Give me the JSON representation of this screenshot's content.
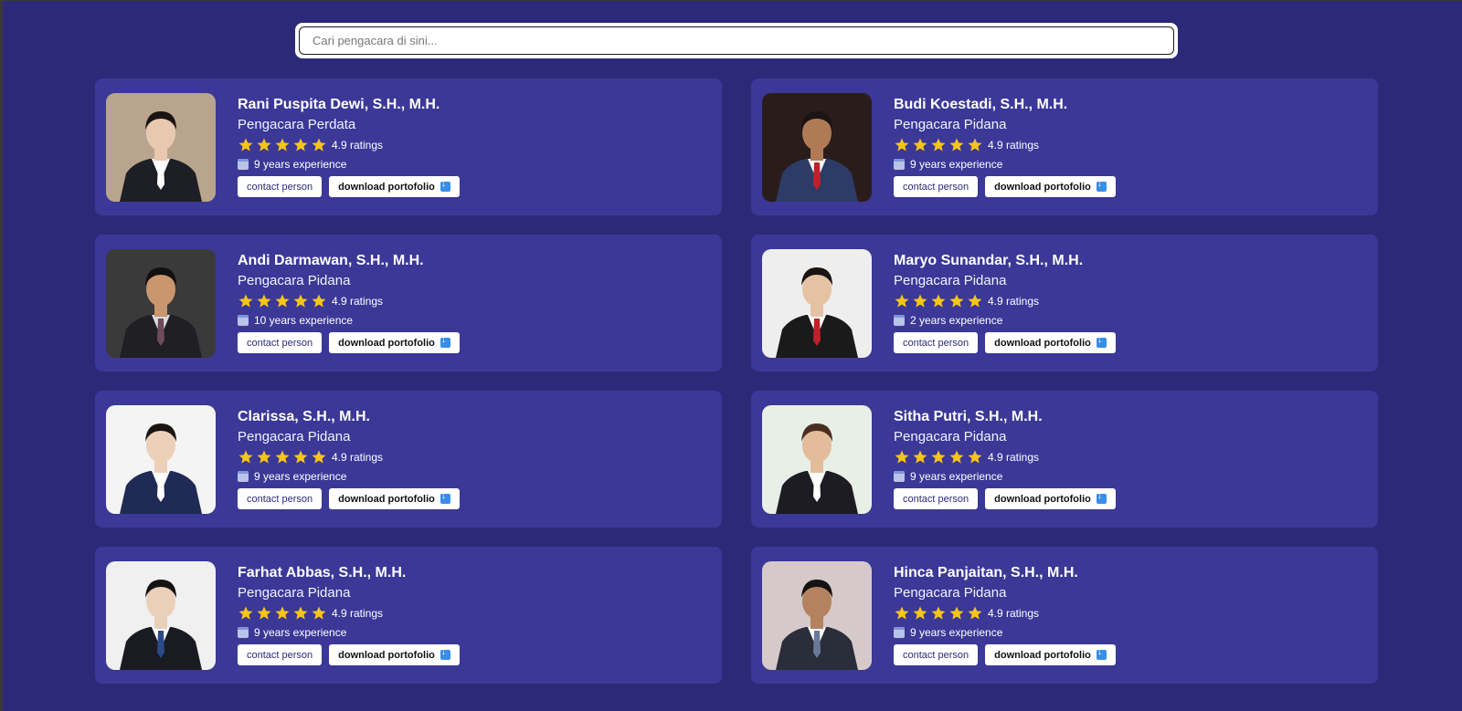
{
  "search": {
    "placeholder": "Cari pengacara di sini..."
  },
  "colors": {
    "background": "#2c2a78",
    "card": "#3b3897",
    "star": "#f5c518"
  },
  "lawyers": [
    {
      "name": "Rani Puspita Dewi, S.H., M.H.",
      "specialty": "Pengacara Perdata",
      "rating": "4.9 ratings",
      "experience": "9 years experience",
      "contact": "contact person",
      "download": "download portofolio",
      "photo": "female-lawyer-desk-photo"
    },
    {
      "name": "Budi Koestadi, S.H., M.H.",
      "specialty": "Pengacara Pidana",
      "rating": "4.9 ratings",
      "experience": "9 years experience",
      "contact": "contact person",
      "download": "download portofolio",
      "photo": "male-lawyer-red-tie-photo"
    },
    {
      "name": "Andi Darmawan, S.H., M.H.",
      "specialty": "Pengacara Pidana",
      "rating": "4.9 ratings",
      "experience": "10 years experience",
      "contact": "contact person",
      "download": "download portofolio",
      "photo": "male-lawyer-glasses-photo"
    },
    {
      "name": "Maryo Sunandar, S.H., M.H.",
      "specialty": "Pengacara Pidana",
      "rating": "4.9 ratings",
      "experience": "2 years experience",
      "contact": "contact person",
      "download": "download portofolio",
      "photo": "male-judge-gavel-photo"
    },
    {
      "name": "Clarissa, S.H., M.H.",
      "specialty": "Pengacara Pidana",
      "rating": "4.9 ratings",
      "experience": "9 years experience",
      "contact": "contact person",
      "download": "download portofolio",
      "photo": "female-lawyer-office-photo"
    },
    {
      "name": "Sitha Putri, S.H., M.H.",
      "specialty": "Pengacara Pidana",
      "rating": "4.9 ratings",
      "experience": "9 years experience",
      "contact": "contact person",
      "download": "download portofolio",
      "photo": "female-lawyer-computer-photo"
    },
    {
      "name": "Farhat Abbas, S.H., M.H.",
      "specialty": "Pengacara Pidana",
      "rating": "4.9 ratings",
      "experience": "9 years experience",
      "contact": "contact person",
      "download": "download portofolio",
      "photo": "male-lawyer-book-photo"
    },
    {
      "name": "Hinca Panjaitan, S.H., M.H.",
      "specialty": "Pengacara Pidana",
      "rating": "4.9 ratings",
      "experience": "9 years experience",
      "contact": "contact person",
      "download": "download portofolio",
      "photo": "male-lawyer-arms-crossed-photo"
    }
  ],
  "photo_styles": [
    {
      "bg": "#b9a58e",
      "suit": "#1e1e26",
      "skin": "#e8c9b0",
      "hair": "#1a1412",
      "tie": "#ffffff",
      "shirt": "#ffffff"
    },
    {
      "bg": "#2b1c1c",
      "suit": "#2c3c66",
      "skin": "#b07a56",
      "hair": "#1a1412",
      "tie": "#c0202a",
      "shirt": "#ffffff"
    },
    {
      "bg": "#3a3a3a",
      "suit": "#1f1f24",
      "skin": "#c9966e",
      "hair": "#121010",
      "tie": "#6e4a5a",
      "shirt": "#dcdcdc"
    },
    {
      "bg": "#eeeeee",
      "suit": "#1a1a1a",
      "skin": "#e6c2a4",
      "hair": "#1a1412",
      "tie": "#c0202a",
      "shirt": "#ffffff"
    },
    {
      "bg": "#f4f4f4",
      "suit": "#1f2a55",
      "skin": "#ecd0b8",
      "hair": "#1a1412",
      "tie": "#ffffff",
      "shirt": "#ffffff"
    },
    {
      "bg": "#e8efe6",
      "suit": "#1c1c22",
      "skin": "#e3bc9c",
      "hair": "#4a2e20",
      "tie": "#ffffff",
      "shirt": "#ffffff"
    },
    {
      "bg": "#f0f0f0",
      "suit": "#1a1a22",
      "skin": "#ead0b8",
      "hair": "#141212",
      "tie": "#2a4a88",
      "shirt": "#ffffff"
    },
    {
      "bg": "#d6c9c9",
      "suit": "#2a2e3a",
      "skin": "#b3825e",
      "hair": "#141212",
      "tie": "#6a7a9a",
      "shirt": "#ffffff"
    }
  ]
}
